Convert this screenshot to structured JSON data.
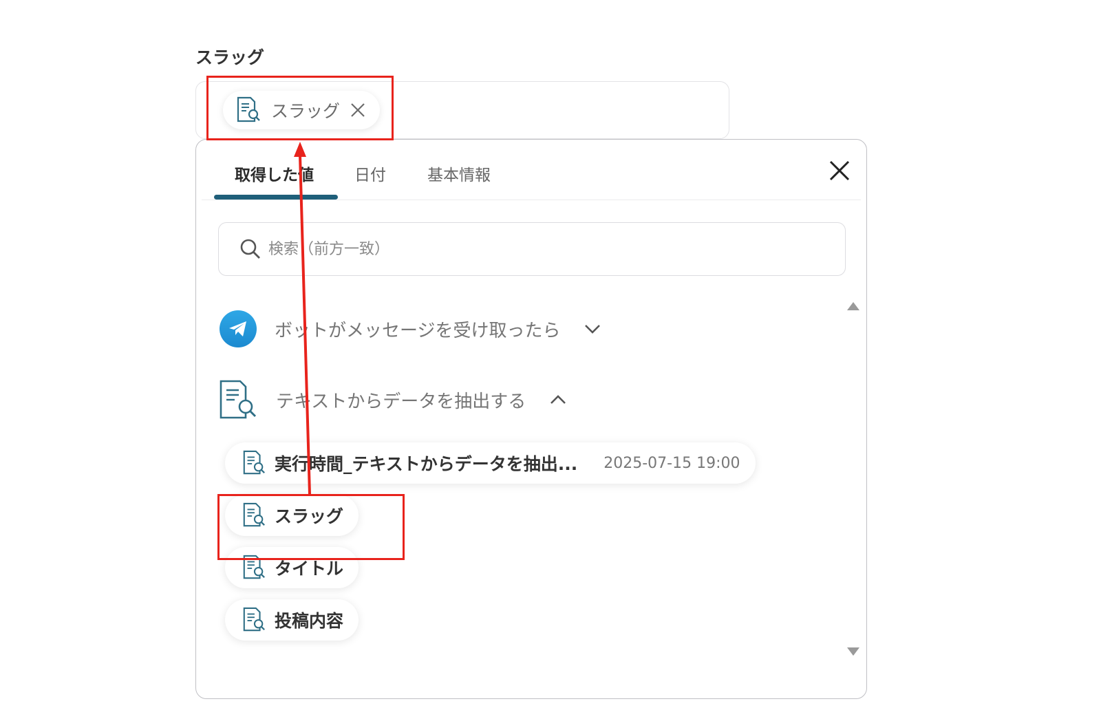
{
  "field": {
    "label": "スラッグ",
    "chip_label": "スラッグ"
  },
  "panel": {
    "tabs": [
      {
        "label": "取得した値"
      },
      {
        "label": "日付"
      },
      {
        "label": "基本情報"
      }
    ],
    "search_placeholder": "検索（前方一致）",
    "sections": [
      {
        "label": "ボットがメッセージを受け取ったら",
        "icon": "telegram-icon",
        "expanded": false
      },
      {
        "label": "テキストからデータを抽出する",
        "icon": "document-search-icon",
        "expanded": true
      }
    ],
    "items": [
      {
        "label": "実行時間_テキストからデータを抽出...",
        "meta": "2025-07-15 19:00"
      },
      {
        "label": "スラッグ"
      },
      {
        "label": "タイトル"
      },
      {
        "label": "投稿内容"
      }
    ]
  },
  "colors": {
    "accent_underline": "#1f5f7a",
    "annotation_red": "#e8231c",
    "telegram_blue": "#2ea7e6",
    "icon_teal": "#2f6f86"
  }
}
